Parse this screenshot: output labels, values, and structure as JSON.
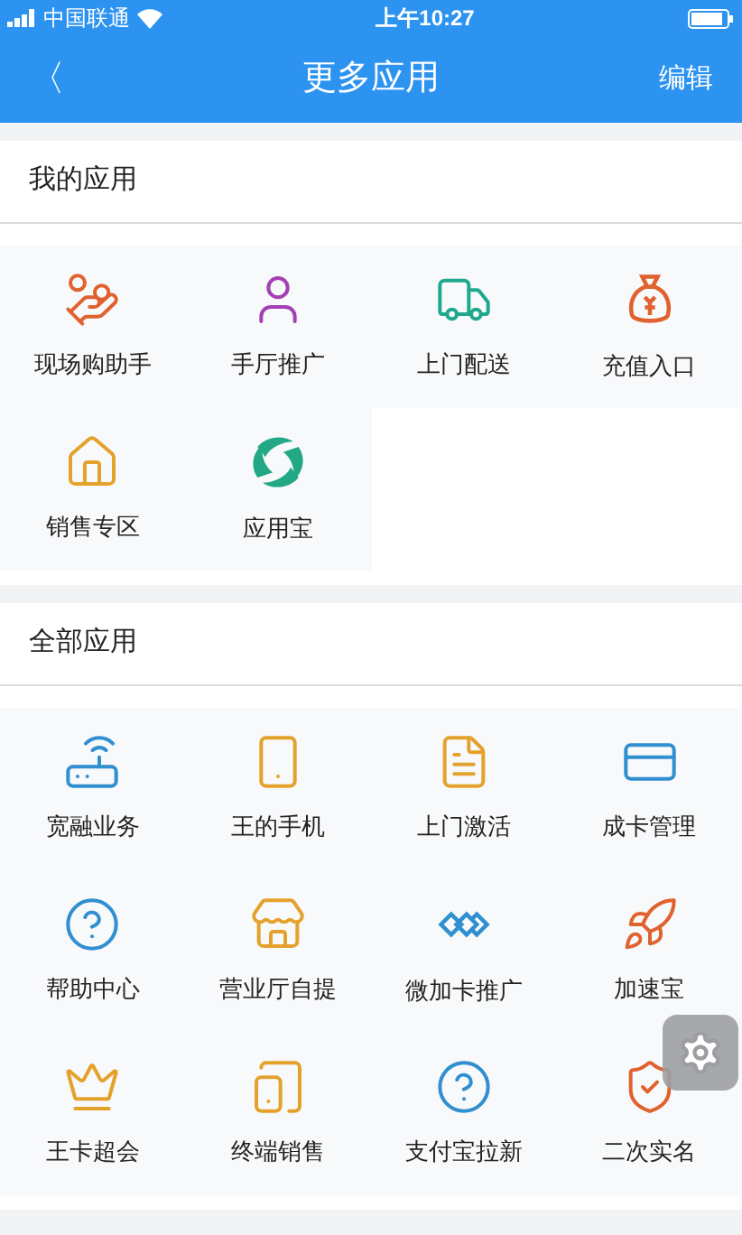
{
  "status_bar": {
    "carrier": "中国联通",
    "time": "上午10:27"
  },
  "nav": {
    "back": "〈",
    "title": "更多应用",
    "action": "编辑"
  },
  "sections": [
    {
      "title": "我的应用",
      "apps": [
        {
          "label": "现场购助手"
        },
        {
          "label": "手厅推广"
        },
        {
          "label": "上门配送"
        },
        {
          "label": "充值入口"
        },
        {
          "label": "销售专区"
        },
        {
          "label": "应用宝"
        }
      ]
    },
    {
      "title": "全部应用",
      "apps": [
        {
          "label": "宽融业务"
        },
        {
          "label": "王的手机"
        },
        {
          "label": "上门激活"
        },
        {
          "label": "成卡管理"
        },
        {
          "label": "帮助中心"
        },
        {
          "label": "营业厅自提"
        },
        {
          "label": "微加卡推广"
        },
        {
          "label": "加速宝"
        },
        {
          "label": "王卡超会"
        },
        {
          "label": "终端销售"
        },
        {
          "label": "支付宝拉新"
        },
        {
          "label": "二次实名"
        }
      ]
    }
  ]
}
